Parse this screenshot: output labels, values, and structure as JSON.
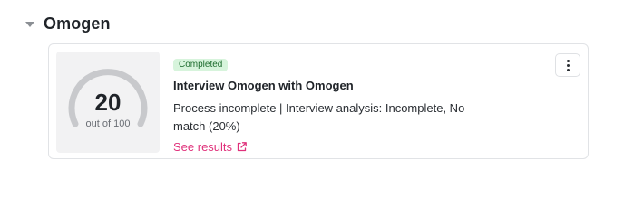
{
  "section": {
    "title": "Omogen"
  },
  "card": {
    "score": {
      "value": "20",
      "subtitle": "out of 100",
      "fraction": 0.2
    },
    "status_badge": "Completed",
    "title": "Interview Omogen with Omogen",
    "description": "Process incomplete | Interview analysis: Incomplete, No match (20%)",
    "link_label": "See results"
  },
  "colors": {
    "badge_bg": "#d7f4dc",
    "badge_text": "#1c6b2d",
    "link": "#e0317b",
    "gauge_track": "#c8c9cc"
  },
  "icons": {
    "section_toggle": "caret-down-icon",
    "link": "external-link-icon",
    "menu": "kebab-menu-icon"
  }
}
